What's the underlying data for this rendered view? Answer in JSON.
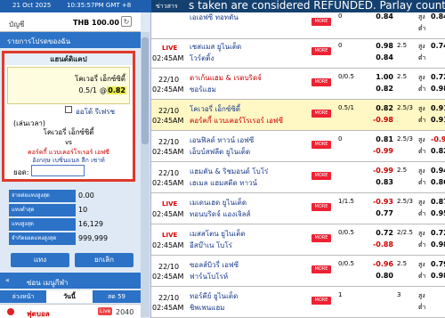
{
  "topbar": {
    "date": "21 Oct 2025",
    "time": "10:35:57PM GMT +8",
    "news_label": "ข่าวสาร",
    "news_text": "s taken are considered REFUNDED. Parlay counted as c"
  },
  "account": {
    "label": "บัญชี",
    "balance": "THB 100.00",
    "refresh_icon": "refresh-icon"
  },
  "bet_header": "รายการโปรดของฉัน",
  "slip": {
    "title": "แฮนด์ดิแคป",
    "team": "โคเวอรี่ เอ็กซ์ซิตี้",
    "handicap": "0.5/1",
    "at": "@",
    "odds": "0.82",
    "accept_label": "ออโต้ รีเฟรช",
    "live_label": "(เล่นเวลา)",
    "team_a": "โคเวอรี่ เอ็กซ์ซิตี้",
    "vs": "vs",
    "match_line1": "คอร์คกี้ แวบเคอร์โรเรอร์ เอฟซี",
    "match_line2": "อังกฤษ เบซิ่นแนล ลีก เซาท์",
    "amount_label": "ยอด:",
    "amount_value": ""
  },
  "stats": [
    {
      "label": "จ่ายต่อแทงสูงสุด",
      "value": "0.00"
    },
    {
      "label": "แทงต่ำสุด",
      "value": "10"
    },
    {
      "label": "แทงสูงสุด",
      "value": "16,129"
    },
    {
      "label": "จำกัดยอดแทงสูงสุด",
      "value": "999,999"
    }
  ],
  "buttons": {
    "bet": "แทง",
    "cancel": "ยกเลิก"
  },
  "hide_menu": "ซ่อน เมนูกีฬา",
  "tabs": {
    "early": "ล่วงหน้า",
    "today": "วันนี้",
    "live": "สด",
    "live_count": "59"
  },
  "sport": {
    "name": "ฟุตบอล",
    "live_badge": "Live",
    "count": "2040"
  },
  "rows": [
    {
      "live": false,
      "date": "",
      "time": "",
      "home": "เอเอฟซี ทอทตัน",
      "away": "",
      "home_red": false,
      "away_red": false,
      "hdp": "0",
      "o1": "0.84",
      "o2": "",
      "o1_neg": false,
      "o2_neg": false,
      "ou": "",
      "p1": "0.84",
      "p2": "",
      "p1_neg": false,
      "p2_neg": false
    },
    {
      "live": true,
      "date": "",
      "time": "02:45AM",
      "home": "เชสแมส ยูไนเต็ด",
      "away": "โวร์ตติ้ง",
      "home_red": false,
      "away_red": false,
      "hdp": "0",
      "o1": "0.98",
      "o2": "0.84",
      "o1_neg": false,
      "o2_neg": false,
      "ou": "2.5",
      "p1": "0.74",
      "p2": "",
      "p1_neg": false,
      "p2_neg": false
    },
    {
      "live": false,
      "date": "22/10",
      "time": "02:45AM",
      "home": "ดาเก้นแฮม & เรดบริดจ์",
      "away": "ซอร์แฮม",
      "home_red": true,
      "away_red": false,
      "hdp": "0/0.5",
      "o1": "1.00",
      "o2": "0.82",
      "o1_neg": false,
      "o2_neg": false,
      "ou": "2.5",
      "p1": "0.72",
      "p2": "0.98",
      "p1_neg": false,
      "p2_neg": false
    },
    {
      "live": false,
      "date": "22/10",
      "time": "02:45AM",
      "home": "โคเวอรี่ เอ็กซ์ซิตี้",
      "away": "คอร์คกี้ แวบเคอร์โรเรอร์ เอฟซี",
      "home_red": false,
      "away_red": true,
      "hdp": "0.5/1",
      "o1": "0.82",
      "o2": "-0.98",
      "o1_neg": false,
      "o2_neg": true,
      "ou": "2.5/3",
      "p1": "0.91",
      "p2": "0.91",
      "p1_neg": false,
      "p2_neg": false
    },
    {
      "live": false,
      "date": "22/10",
      "time": "02:45AM",
      "home": "เอนฟิลด์ ทาวน์ เอฟซี",
      "away": "เอ็บบ์สฟลีต ยูไนเต็ด",
      "home_red": false,
      "away_red": false,
      "hdp": "0",
      "o1": "0.81",
      "o2": "-0.99",
      "o1_neg": false,
      "o2_neg": true,
      "ou": "2.5/3",
      "p1": "-0.98",
      "p2": "0.82",
      "p1_neg": true,
      "p2_neg": false
    },
    {
      "live": false,
      "date": "22/10",
      "time": "02:45AM",
      "home": "แฮมตัน & ริชมอนด์ โบโร่",
      "away": "เฮเมล แฮมสตีด ทาวน์",
      "home_red": false,
      "away_red": false,
      "hdp": "",
      "o1": "-0.99",
      "o2": "0.83",
      "o1_neg": true,
      "o2_neg": false,
      "ou": "2.5",
      "p1": "0.94",
      "p2": "0.86",
      "p1_neg": false,
      "p2_neg": false
    },
    {
      "live": true,
      "date": "",
      "time": "02:45AM",
      "home": "เมเดนเฮด ยูไนเต็ด",
      "away": "ทอนบริดจ์ แองเจิลส์",
      "home_red": false,
      "away_red": false,
      "hdp": "1/1.5",
      "o1": "-0.93",
      "o2": "0.77",
      "o1_neg": true,
      "o2_neg": false,
      "ou": "2.5/3",
      "p1": "0.87",
      "p2": "0.95",
      "p1_neg": false,
      "p2_neg": false
    },
    {
      "live": true,
      "date": "",
      "time": "02:45AM",
      "home": "เมสสโตน ยูไนเต็ด",
      "away": "อีสบ๊าเน โบโร่",
      "home_red": false,
      "away_red": false,
      "hdp": "0/0.5",
      "o1": "0.72",
      "o2": "-0.88",
      "o1_neg": false,
      "o2_neg": true,
      "ou": "2/2.5",
      "p1": "0.72",
      "p2": "0.98",
      "p1_neg": false,
      "p2_neg": false
    },
    {
      "live": false,
      "date": "22/10",
      "time": "02:45AM",
      "home": "ซอลส์บิวรี่ เอฟซี",
      "away": "ฟาร์นโบโรห์",
      "home_red": false,
      "away_red": false,
      "hdp": "0/0.5",
      "o1": "-0.96",
      "o2": "0.80",
      "o1_neg": true,
      "o2_neg": false,
      "ou": "2.5",
      "p1": "0.79",
      "p2": "0.98",
      "p1_neg": false,
      "p2_neg": false
    },
    {
      "live": false,
      "date": "22/10",
      "time": "02:45AM",
      "home": "ทอร์คีย์ ยูไนเต็ด",
      "away": "ชิพเพนแฮม",
      "home_red": false,
      "away_red": false,
      "hdp": "1",
      "o1": "",
      "o2": "",
      "o1_neg": false,
      "o2_neg": false,
      "ou": "3",
      "p1": "",
      "p2": "",
      "p1_neg": false,
      "p2_neg": false
    }
  ],
  "labels": {
    "more": "MORE",
    "over": "สูง",
    "under": "ต่ำ"
  }
}
